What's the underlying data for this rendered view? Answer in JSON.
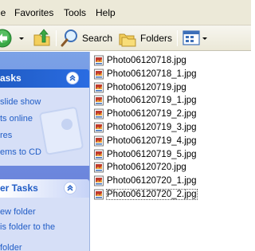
{
  "menubar": {
    "items": [
      {
        "label": "le"
      },
      {
        "label": "Favorites"
      },
      {
        "label": "Tools"
      },
      {
        "label": "Help"
      }
    ]
  },
  "toolbar": {
    "search_label": "Search",
    "folders_label": "Folders",
    "icons": [
      "back-arrow-icon",
      "dropdown-arrow-icon",
      "up-folder-icon",
      "search-magnifier-icon",
      "folders-icon",
      "views-icon"
    ]
  },
  "taskpane": {
    "picture_tasks": {
      "title": "asks",
      "links": [
        "slide show",
        "ts online",
        "res",
        "ems to CD"
      ]
    },
    "file_tasks": {
      "title": "er Tasks",
      "links": [
        "ew folder",
        "is folder to the",
        "folder"
      ]
    }
  },
  "files": [
    {
      "name": "Photo06120718.jpg"
    },
    {
      "name": "Photo06120718_1.jpg"
    },
    {
      "name": "Photo06120719.jpg"
    },
    {
      "name": "Photo06120719_1.jpg"
    },
    {
      "name": "Photo06120719_2.jpg"
    },
    {
      "name": "Photo06120719_3.jpg"
    },
    {
      "name": "Photo06120719_4.jpg"
    },
    {
      "name": "Photo06120719_5.jpg"
    },
    {
      "name": "Photo06120720.jpg"
    },
    {
      "name": "Photo06120720_1.jpg"
    },
    {
      "name": "Photo06120720_2.jpg"
    }
  ],
  "selected_file": "Photo06120720_2.jpg",
  "colors": {
    "menubar_bg": "#ece9d8",
    "taskpane_bg": "#6f8fdd",
    "panel_header_blue": "#215dc6",
    "link_blue": "#215dc6",
    "back_button_green": "#3aa845"
  }
}
